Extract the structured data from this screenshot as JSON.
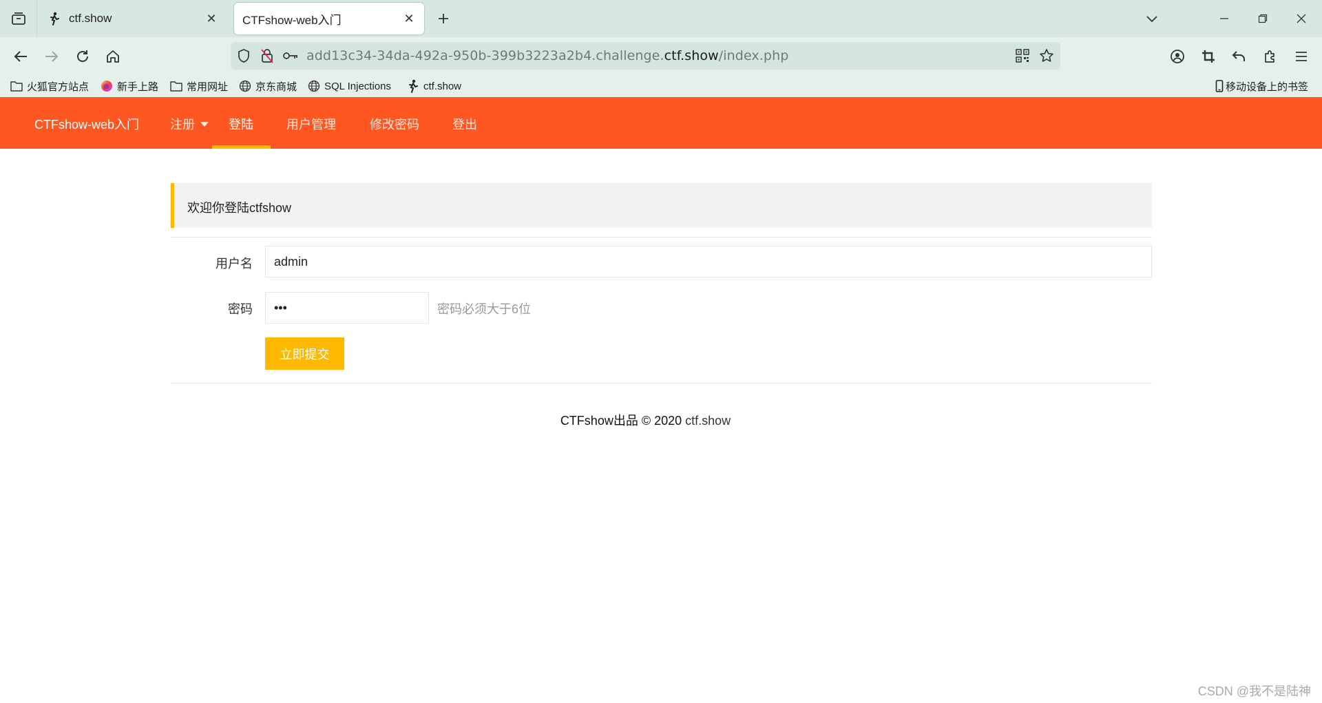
{
  "browser": {
    "tabs": [
      {
        "title": "ctf.show",
        "active": false
      },
      {
        "title": "CTFshow-web入门",
        "active": true
      }
    ],
    "url": {
      "prefix": "add13c34-34da-492a-950b-399b3223a2b4.challenge.",
      "domain": "ctf.show",
      "path": "/index.php"
    },
    "bookmarks": [
      {
        "label": "火狐官方站点",
        "icon": "folder-icon"
      },
      {
        "label": "新手上路",
        "icon": "firefox-icon"
      },
      {
        "label": "常用网址",
        "icon": "folder-icon"
      },
      {
        "label": "京东商城",
        "icon": "globe-icon"
      },
      {
        "label": "SQL Injections",
        "icon": "globe-icon"
      },
      {
        "label": "ctf.show",
        "icon": "ctfshow-icon"
      }
    ],
    "mobile_bookmarks": "移动设备上的书签"
  },
  "site_nav": {
    "brand": "CTFshow-web入门",
    "items": [
      {
        "label": "注册",
        "has_dropdown": true
      },
      {
        "label": "登陆",
        "active": true
      },
      {
        "label": "用户管理"
      },
      {
        "label": "修改密码"
      },
      {
        "label": "登出"
      }
    ],
    "bg_color": "#ff5722",
    "accent_color": "#ffb800"
  },
  "login": {
    "welcome": "欢迎你登陆ctfshow",
    "username_label": "用户名",
    "username_value": "admin",
    "password_label": "密码",
    "password_value": "abc",
    "password_hint": "密码必须大于6位",
    "submit_label": "立即提交"
  },
  "footer": {
    "text": "CTFshow出品 © 2020 ",
    "link": "ctf.show"
  },
  "watermark": "CSDN @我不是陆神"
}
